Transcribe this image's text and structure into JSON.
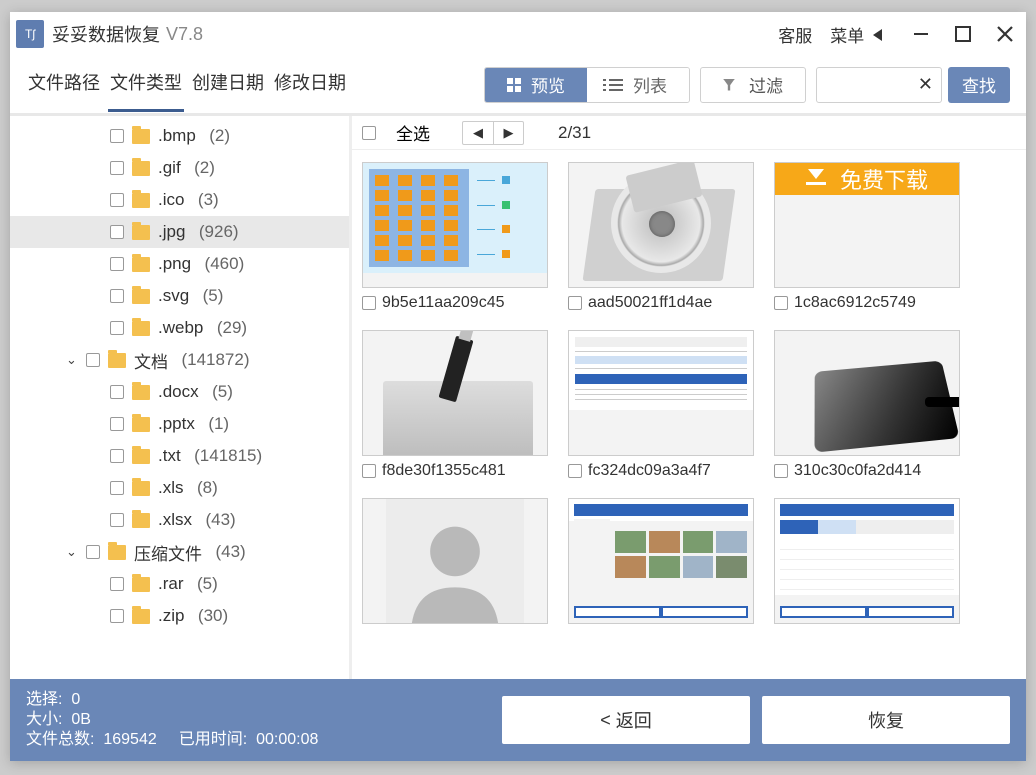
{
  "title": {
    "name": "妥妥数据恢复",
    "version": "V7.8"
  },
  "titlebar": {
    "support": "客服",
    "menu": "菜单"
  },
  "tabs": [
    "文件路径",
    "文件类型",
    "创建日期",
    "修改日期"
  ],
  "active_tab": 1,
  "viewseg": {
    "preview": "预览",
    "list": "列表"
  },
  "filter_label": "过滤",
  "search": {
    "value": "",
    "find": "查找"
  },
  "sidebar": {
    "items": [
      {
        "level": 1,
        "name": ".bmp",
        "count": "(2)"
      },
      {
        "level": 1,
        "name": ".gif",
        "count": "(2)"
      },
      {
        "level": 1,
        "name": ".ico",
        "count": "(3)"
      },
      {
        "level": 1,
        "name": ".jpg",
        "count": "(926)",
        "sel": true
      },
      {
        "level": 1,
        "name": ".png",
        "count": "(460)"
      },
      {
        "level": 1,
        "name": ".svg",
        "count": "(5)"
      },
      {
        "level": 1,
        "name": ".webp",
        "count": "(29)"
      },
      {
        "level": 0,
        "name": "文档",
        "count": "(141872)",
        "caret": "v"
      },
      {
        "level": 1,
        "name": ".docx",
        "count": "(5)"
      },
      {
        "level": 1,
        "name": ".pptx",
        "count": "(1)"
      },
      {
        "level": 1,
        "name": ".txt",
        "count": "(141815)"
      },
      {
        "level": 1,
        "name": ".xls",
        "count": "(8)"
      },
      {
        "level": 1,
        "name": ".xlsx",
        "count": "(43)"
      },
      {
        "level": 0,
        "name": "压缩文件",
        "count": "(43)",
        "caret": "v"
      },
      {
        "level": 1,
        "name": ".rar",
        "count": "(5)"
      },
      {
        "level": 1,
        "name": ".zip",
        "count": "(30)"
      }
    ]
  },
  "mainbar": {
    "select_all": "全选",
    "pager": "2/31"
  },
  "thumbs": [
    {
      "name": "9b5e11aa209c45",
      "kind": "chips"
    },
    {
      "name": "aad50021ff1d4ae",
      "kind": "hdd"
    },
    {
      "name": "1c8ac6912c5749",
      "kind": "download",
      "text": "免费下载"
    },
    {
      "name": "f8de30f1355c481",
      "kind": "usbhdd"
    },
    {
      "name": "fc324dc09a3a4f7",
      "kind": "dialog"
    },
    {
      "name": "310c30c0fa2d414",
      "kind": "ssd"
    },
    {
      "name": "",
      "kind": "avatar"
    },
    {
      "name": "",
      "kind": "app1"
    },
    {
      "name": "",
      "kind": "app2"
    }
  ],
  "footer": {
    "sel_label": "选择:",
    "sel_val": "0",
    "size_label": "大小:",
    "size_val": "0B",
    "total_label": "文件总数:",
    "total_val": "169542",
    "time_label": "已用时间:",
    "time_val": "00:00:08",
    "back": "返回",
    "recover": "恢复"
  }
}
